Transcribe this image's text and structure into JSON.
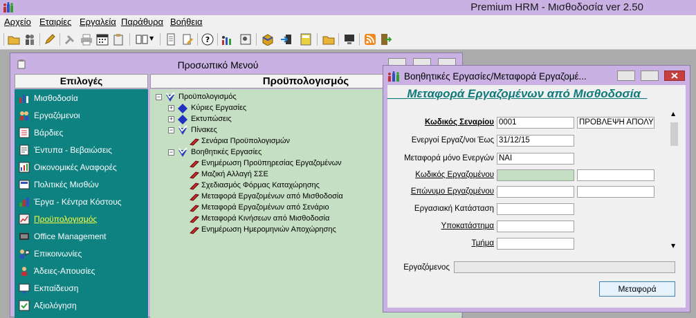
{
  "window": {
    "title": "Premium HRM - Μισθοδοσία ver 2.50"
  },
  "menubar": [
    {
      "label": "Αρχείο"
    },
    {
      "label": "Εταιρίες"
    },
    {
      "label": "Εργαλεία"
    },
    {
      "label": "Παράθυρα"
    },
    {
      "label": "Βοήθεια"
    }
  ],
  "personal_menu": {
    "title": "Προσωπικό Μενού",
    "left_header": "Επιλογές",
    "right_header": "Προϋπολογισμός",
    "items": [
      {
        "label": "Μισθοδοσία"
      },
      {
        "label": "Εργαζόμενοι"
      },
      {
        "label": "Βάρδιες"
      },
      {
        "label": "Έντυπα - Βεβαιώσεις"
      },
      {
        "label": "Οικονομικές Αναφορές"
      },
      {
        "label": "Πολιτικές Μισθών"
      },
      {
        "label": "Έργα - Κέντρα Κόστους"
      },
      {
        "label": "Προϋπολογισμός"
      },
      {
        "label": "Office Management"
      },
      {
        "label": "Επικοινωνίες"
      },
      {
        "label": "Άδειες-Απουσίες"
      },
      {
        "label": "Εκπαίδευση"
      },
      {
        "label": "Αξιολόγηση"
      }
    ],
    "tree": [
      {
        "label": "Προϋπολογισμός"
      },
      {
        "label": "Κύριες Εργασίες"
      },
      {
        "label": "Εκτυπώσεις"
      },
      {
        "label": "Πίνακες"
      },
      {
        "label": "Σενάρια Προϋπολογισμών"
      },
      {
        "label": "Βοηθητικές Εργασίες"
      },
      {
        "label": "Ενημέρωση Προϋπηρεσίας Εργαζομένων"
      },
      {
        "label": "Μαζική Αλλαγή ΣΣΕ"
      },
      {
        "label": "Σχεδιασμός Φόρμας Καταχώρησης"
      },
      {
        "label": "Μεταφορά Εργαζομένων από Μισθοδοσία"
      },
      {
        "label": "Μεταφορά Εργαζομένων από Σενάριο"
      },
      {
        "label": "Μεταφορά Κινήσεων από Μισθοδοσία"
      },
      {
        "label": "Ενημέρωση Ημερομηνιών Αποχώρησης"
      }
    ]
  },
  "dialog": {
    "title": "Βοηθητικές Εργασίες/Μεταφορά Εργαζομέ...",
    "heading": "___Μεταφορά Εργαζομένων από Μισθοδοσία_",
    "fields": {
      "scenario_code": {
        "label": "Κωδικός Σεναρίου",
        "value": "0001",
        "extra": "ΠΡΟΒΛΕΨΗ ΑΠΟΛΥΣΗ"
      },
      "active_until": {
        "label": "Ενεργοί Εργαζ/νοι Έως",
        "value": "31/12/15"
      },
      "only_active": {
        "label": "Μεταφορά μόνο Ενεργών",
        "value": "ΝΑΙ"
      },
      "employee_code": {
        "label": "Κωδικός Εργαζομένου",
        "value": ""
      },
      "employee_surname": {
        "label": "Επώνυμο Εργαζομένου",
        "value": ""
      },
      "work_status": {
        "label": "Εργασιακή Κατάσταση",
        "value": ""
      },
      "branch": {
        "label": "Υποκατάστημα",
        "value": ""
      },
      "department": {
        "label": "Τμήμα",
        "value": ""
      },
      "employee": {
        "label": "Εργαζόμενος",
        "value": ""
      }
    },
    "button": "Μεταφορά"
  }
}
